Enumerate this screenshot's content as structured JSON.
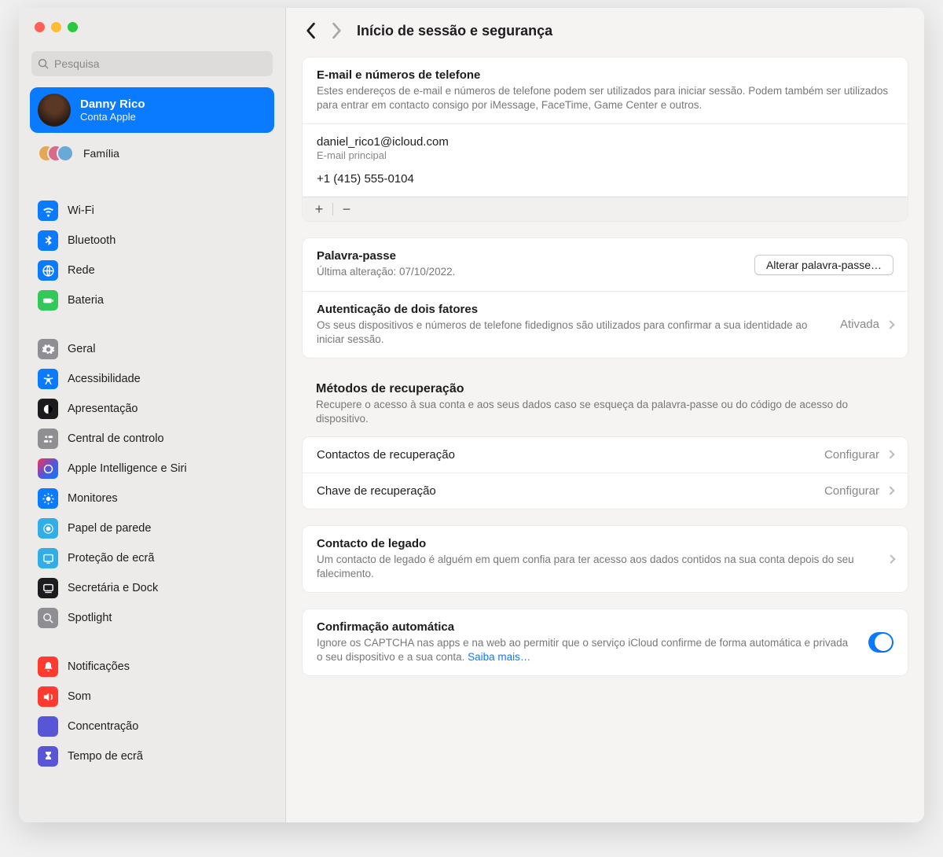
{
  "window": {
    "traffic": [
      "close",
      "minimize",
      "zoom"
    ]
  },
  "search": {
    "placeholder": "Pesquisa"
  },
  "account": {
    "name": "Danny Rico",
    "subtitle": "Conta Apple"
  },
  "family": {
    "label": "Família"
  },
  "sidebar": {
    "items1": [
      {
        "label": "Wi-Fi"
      },
      {
        "label": "Bluetooth"
      },
      {
        "label": "Rede"
      },
      {
        "label": "Bateria"
      }
    ],
    "items2": [
      {
        "label": "Geral"
      },
      {
        "label": "Acessibilidade"
      },
      {
        "label": "Apresentação"
      },
      {
        "label": "Central de controlo"
      },
      {
        "label": "Apple Intelligence e Siri"
      },
      {
        "label": "Monitores"
      },
      {
        "label": "Papel de parede"
      },
      {
        "label": "Proteção de ecrã"
      },
      {
        "label": "Secretária e Dock"
      },
      {
        "label": "Spotlight"
      }
    ],
    "items3": [
      {
        "label": "Notificações"
      },
      {
        "label": "Som"
      },
      {
        "label": "Concentração"
      },
      {
        "label": "Tempo de ecrã"
      }
    ]
  },
  "header": {
    "title": "Início de sessão e segurança"
  },
  "email_section": {
    "title": "E-mail e números de telefone",
    "desc": "Estes endereços de e-mail e números de telefone podem ser utilizados para iniciar sessão. Podem também ser utilizados para entrar em contacto consigo por iMessage, FaceTime, Game Center e outros.",
    "primary_email": "daniel_rico1@icloud.com",
    "primary_label": "E-mail principal",
    "phone": "+1 (415) 555-0104"
  },
  "password": {
    "title": "Palavra-passe",
    "subtitle": "Última alteração: 07/10/2022.",
    "button": "Alterar palavra-passe…"
  },
  "twofa": {
    "title": "Autenticação de dois fatores",
    "desc": "Os seus dispositivos e números de telefone fidedignos são utilizados para confirmar a sua identidade ao iniciar sessão.",
    "status": "Ativada"
  },
  "recovery": {
    "heading": "Métodos de recuperação",
    "desc": "Recupere o acesso à sua conta e aos seus dados caso se esqueça da palavra-passe ou do código de acesso do dispositivo.",
    "contacts_label": "Contactos de recuperação",
    "key_label": "Chave de recuperação",
    "action": "Configurar"
  },
  "legacy": {
    "title": "Contacto de legado",
    "desc": "Um contacto de legado é alguém em quem confia para ter acesso aos dados contidos na sua conta depois do seu falecimento."
  },
  "autoconfirm": {
    "title": "Confirmação automática",
    "desc": "Ignore os CAPTCHA nas apps e na web ao permitir que o serviço iCloud confirme de forma automática e privada o seu dispositivo e a sua conta. ",
    "link": "Saiba mais…",
    "enabled": true
  }
}
